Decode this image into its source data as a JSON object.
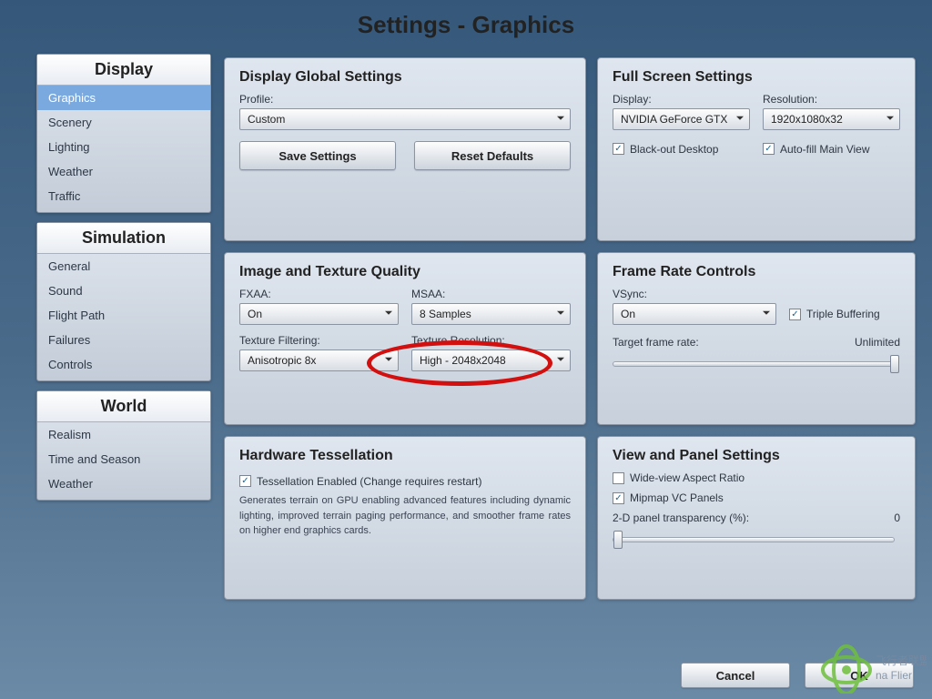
{
  "title": "Settings - Graphics",
  "sidebar": {
    "groups": [
      {
        "header": "Display",
        "items": [
          "Graphics",
          "Scenery",
          "Lighting",
          "Weather",
          "Traffic"
        ],
        "selected": 0
      },
      {
        "header": "Simulation",
        "items": [
          "General",
          "Sound",
          "Flight Path",
          "Failures",
          "Controls"
        ],
        "selected": -1
      },
      {
        "header": "World",
        "items": [
          "Realism",
          "Time and Season",
          "Weather"
        ],
        "selected": -1
      }
    ]
  },
  "global": {
    "title": "Display Global Settings",
    "profile_label": "Profile:",
    "profile_value": "Custom",
    "save_label": "Save Settings",
    "reset_label": "Reset Defaults"
  },
  "fullscreen": {
    "title": "Full Screen Settings",
    "display_label": "Display:",
    "display_value": "NVIDIA GeForce GTX !",
    "resolution_label": "Resolution:",
    "resolution_value": "1920x1080x32",
    "blackout_label": "Black-out Desktop",
    "blackout_checked": true,
    "autofill_label": "Auto-fill Main View",
    "autofill_checked": true
  },
  "image_quality": {
    "title": "Image and Texture Quality",
    "fxaa_label": "FXAA:",
    "fxaa_value": "On",
    "msaa_label": "MSAA:",
    "msaa_value": "8 Samples",
    "texfilter_label": "Texture Filtering:",
    "texfilter_value": "Anisotropic 8x",
    "texres_label": "Texture Resolution:",
    "texres_value": "High - 2048x2048"
  },
  "framerate": {
    "title": "Frame Rate Controls",
    "vsync_label": "VSync:",
    "vsync_value": "On",
    "triple_label": "Triple Buffering",
    "triple_checked": true,
    "target_label": "Target frame rate:",
    "target_value": "Unlimited",
    "target_slider_percent": 100
  },
  "tess": {
    "title": "Hardware Tessellation",
    "enabled_label": "Tessellation Enabled (Change requires restart)",
    "enabled_checked": true,
    "description": "Generates terrain on GPU enabling advanced features including dynamic lighting, improved terrain paging performance, and smoother frame rates on higher end graphics cards."
  },
  "view": {
    "title": "View and Panel Settings",
    "wide_label": "Wide-view Aspect Ratio",
    "wide_checked": false,
    "mipmap_label": "Mipmap VC Panels",
    "mipmap_checked": true,
    "transparency_label": "2-D panel transparency (%):",
    "transparency_value": "0",
    "transparency_slider_percent": 0
  },
  "footer": {
    "cancel": "Cancel",
    "ok": "OK"
  },
  "watermark": {
    "line1": "飞行者联盟",
    "line2": "na Flier"
  }
}
